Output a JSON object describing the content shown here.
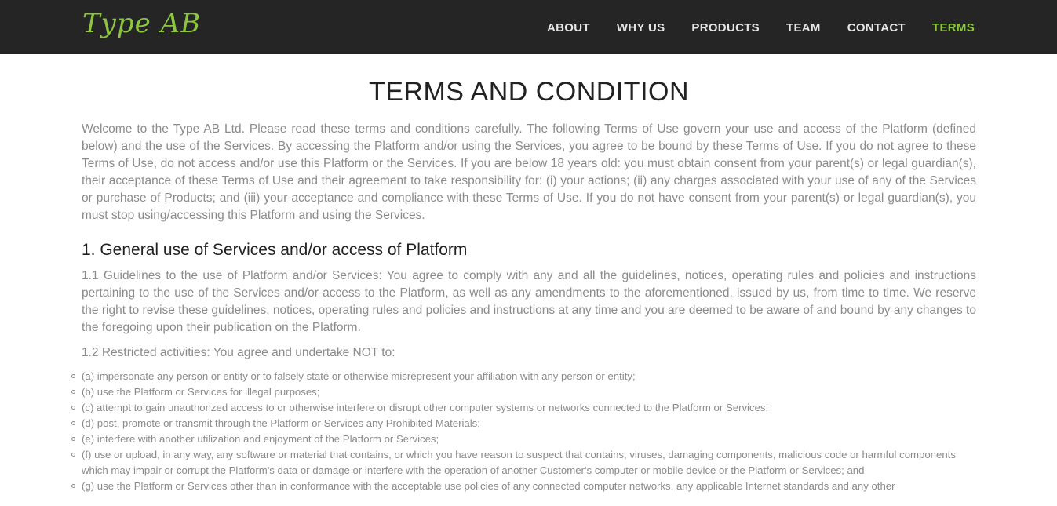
{
  "brand": {
    "logo_text": "Type AB"
  },
  "nav": {
    "items": [
      {
        "label": "ABOUT"
      },
      {
        "label": "WHY US"
      },
      {
        "label": "PRODUCTS"
      },
      {
        "label": "TEAM"
      },
      {
        "label": "CONTACT"
      },
      {
        "label": "TERMS"
      }
    ],
    "active": "TERMS"
  },
  "colors": {
    "accent": "#8cc63f",
    "navbar_bg": "#252525",
    "body_text": "#8b8b8b",
    "heading_text": "#222222"
  },
  "page": {
    "title": "TERMS AND CONDITION",
    "intro": "Welcome to the Type AB Ltd. Please read these terms and conditions carefully. The following Terms of Use govern your use and access of the Platform (defined below) and the use of the Services. By accessing the Platform and/or using the Services, you agree to be bound by these Terms of Use. If you do not agree to these Terms of Use, do not access and/or use this Platform or the Services. If you are below 18 years old: you must obtain consent from your parent(s) or legal guardian(s), their acceptance of these Terms of Use and their agreement to take responsibility for: (i) your actions; (ii) any charges associated with your use of any of the Services or purchase of Products; and (iii) your acceptance and compliance with these Terms of Use. If you do not have consent from your parent(s) or legal guardian(s), you must stop using/accessing this Platform and using the Services.",
    "section1": {
      "heading": "1. General use of Services and/or access of Platform",
      "p1_1": "1.1 Guidelines to the use of Platform and/or Services: You agree to comply with any and all the guidelines, notices, operating rules and policies and instructions pertaining to the use of the Services and/or access to the Platform, as well as any amendments to the aforementioned, issued by us, from time to time. We reserve the right to revise these guidelines, notices, operating rules and policies and instructions at any time and you are deemed to be aware of and bound by any changes to the foregoing upon their publication on the Platform.",
      "p1_2": "1.2 Restricted activities: You agree and undertake NOT to:",
      "items": [
        "(a) impersonate any person or entity or to falsely state or otherwise misrepresent your affiliation with any person or entity;",
        "(b) use the Platform or Services for illegal purposes;",
        "(c) attempt to gain unauthorized access to or otherwise interfere or disrupt other computer systems or networks connected to the Platform or Services;",
        "(d) post, promote or transmit through the Platform or Services any Prohibited Materials;",
        "(e) interfere with another utilization and enjoyment of the Platform or Services;",
        "(f) use or upload, in any way, any software or material that contains, or which you have reason to suspect that contains, viruses, damaging components, malicious code or harmful components which may impair or corrupt the Platform's data or damage or interfere with the operation of another Customer's computer or mobile device or the Platform or Services; and",
        "(g) use the Platform or Services other than in conformance with the acceptable use policies of any connected computer networks, any applicable Internet standards and any other"
      ]
    }
  }
}
